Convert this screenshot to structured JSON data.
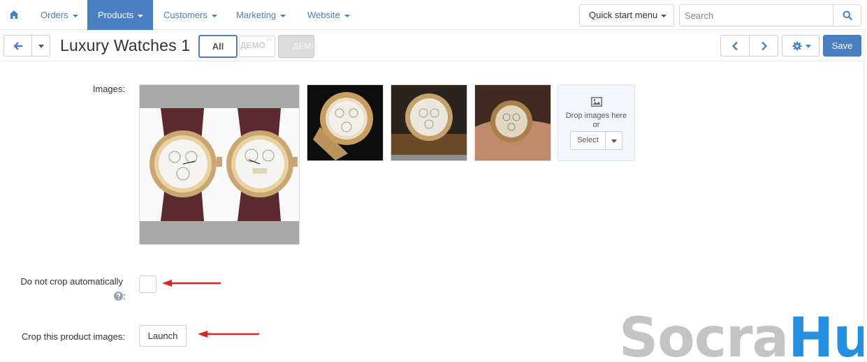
{
  "topnav": {
    "items": [
      {
        "label": "Orders"
      },
      {
        "label": "Products"
      },
      {
        "label": "Customers"
      },
      {
        "label": "Marketing"
      },
      {
        "label": "Website"
      }
    ],
    "quick_start": "Quick start menu",
    "search_placeholder": "Search",
    "accent_color": "#4a7fc1"
  },
  "toolbar": {
    "title": "Luxury Watches 1",
    "tabs": [
      {
        "label": "All"
      },
      {
        "label": "ДЕМО",
        "sublabel": "МА"
      },
      {
        "label": "ДЕМО"
      }
    ],
    "save_label": "Save"
  },
  "form": {
    "images_label": "Images:",
    "dropzone_text_1": "Drop images here",
    "dropzone_text_2": "or",
    "select_label": "Select",
    "no_crop_label": "Do not crop automatically",
    "no_crop_suffix": ":",
    "no_crop_checked": false,
    "crop_label": "Crop this product images:",
    "launch_label": "Launch"
  },
  "watermark": {
    "part1": "Socra",
    "part2": "Hub"
  }
}
